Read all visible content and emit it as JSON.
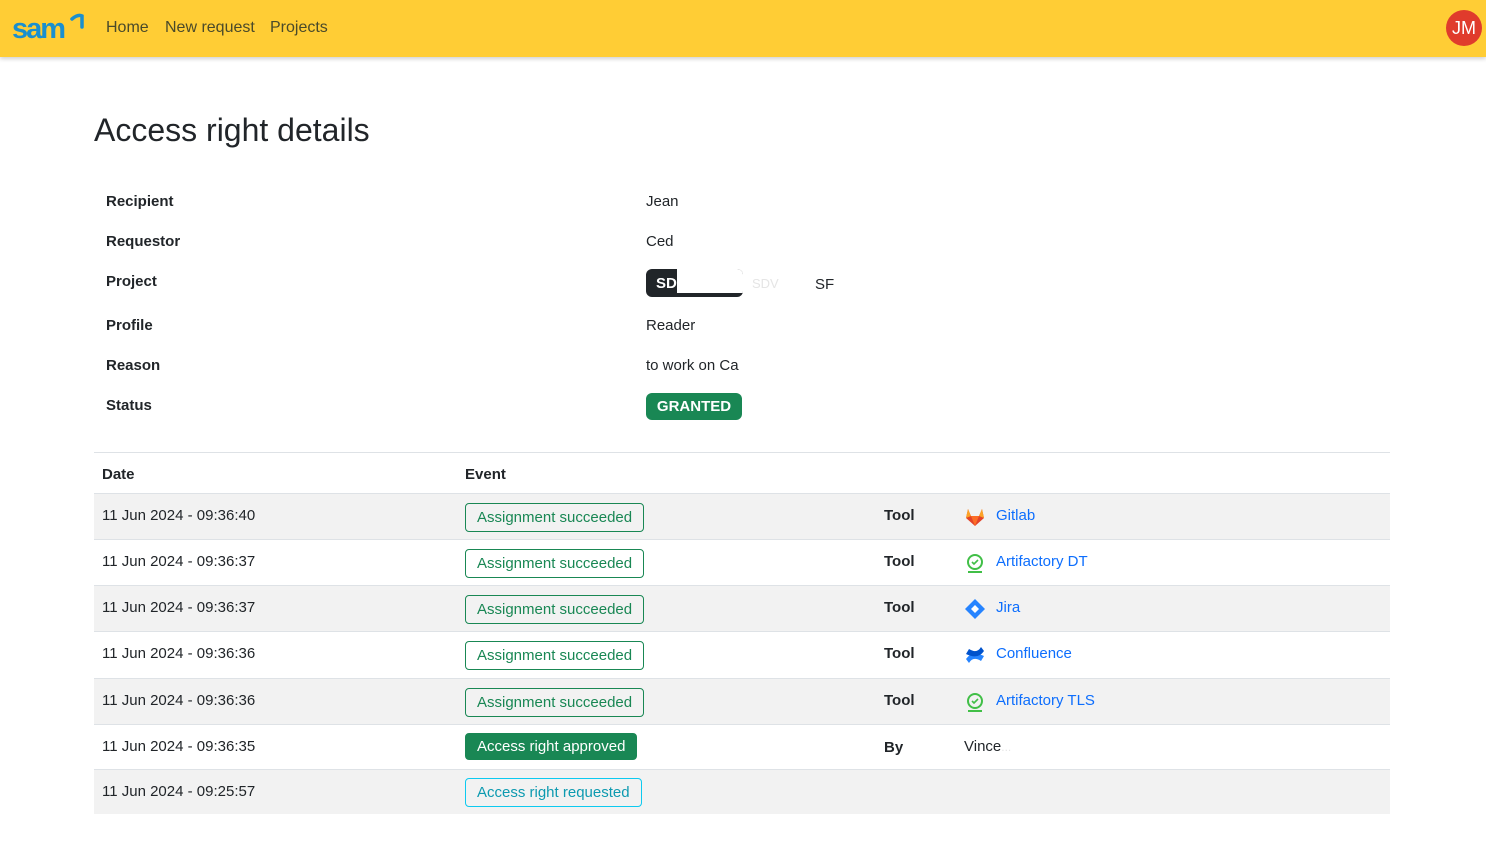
{
  "navbar": {
    "brand": "sam",
    "links": [
      "Home",
      "New request",
      "Projects"
    ],
    "user_initials": "JM",
    "colors": {
      "background": "#ffcd35",
      "avatar": "#e03b2c",
      "logo": "#1a8fcf"
    }
  },
  "page": {
    "title": "Access right details"
  },
  "details": {
    "recipient_label": "Recipient",
    "recipient": "Jean",
    "requestor_label": "Requestor",
    "requestor": "Ced",
    "project_label": "Project",
    "project_code": "SD",
    "project_faded": "SDV",
    "project_suffix": "SF",
    "profile_label": "Profile",
    "profile": "Reader",
    "reason_label": "Reason",
    "reason": "to work on Ca",
    "status_label": "Status",
    "status": "GRANTED"
  },
  "events": {
    "headers": {
      "date": "Date",
      "event": "Event"
    },
    "rows": [
      {
        "date": "11 Jun 2024 - 09:36:40",
        "event": "Assignment succeeded",
        "kind": "Tool",
        "target": "Gitlab",
        "icon": "gitlab-icon"
      },
      {
        "date": "11 Jun 2024 - 09:36:37",
        "event": "Assignment succeeded",
        "kind": "Tool",
        "target": "Artifactory DT",
        "icon": "artifactory-icon"
      },
      {
        "date": "11 Jun 2024 - 09:36:37",
        "event": "Assignment succeeded",
        "kind": "Tool",
        "target": "Jira",
        "icon": "jira-icon"
      },
      {
        "date": "11 Jun 2024 - 09:36:36",
        "event": "Assignment succeeded",
        "kind": "Tool",
        "target": "Confluence",
        "icon": "confluence-icon"
      },
      {
        "date": "11 Jun 2024 - 09:36:36",
        "event": "Assignment succeeded",
        "kind": "Tool",
        "target": "Artifactory TLS",
        "icon": "artifactory-icon"
      },
      {
        "date": "11 Jun 2024 - 09:36:35",
        "event": "Access right approved",
        "kind": "By",
        "target": "Vince",
        "target_faded": "..."
      },
      {
        "date": "11 Jun 2024 - 09:25:57",
        "event": "Access right requested"
      }
    ]
  }
}
